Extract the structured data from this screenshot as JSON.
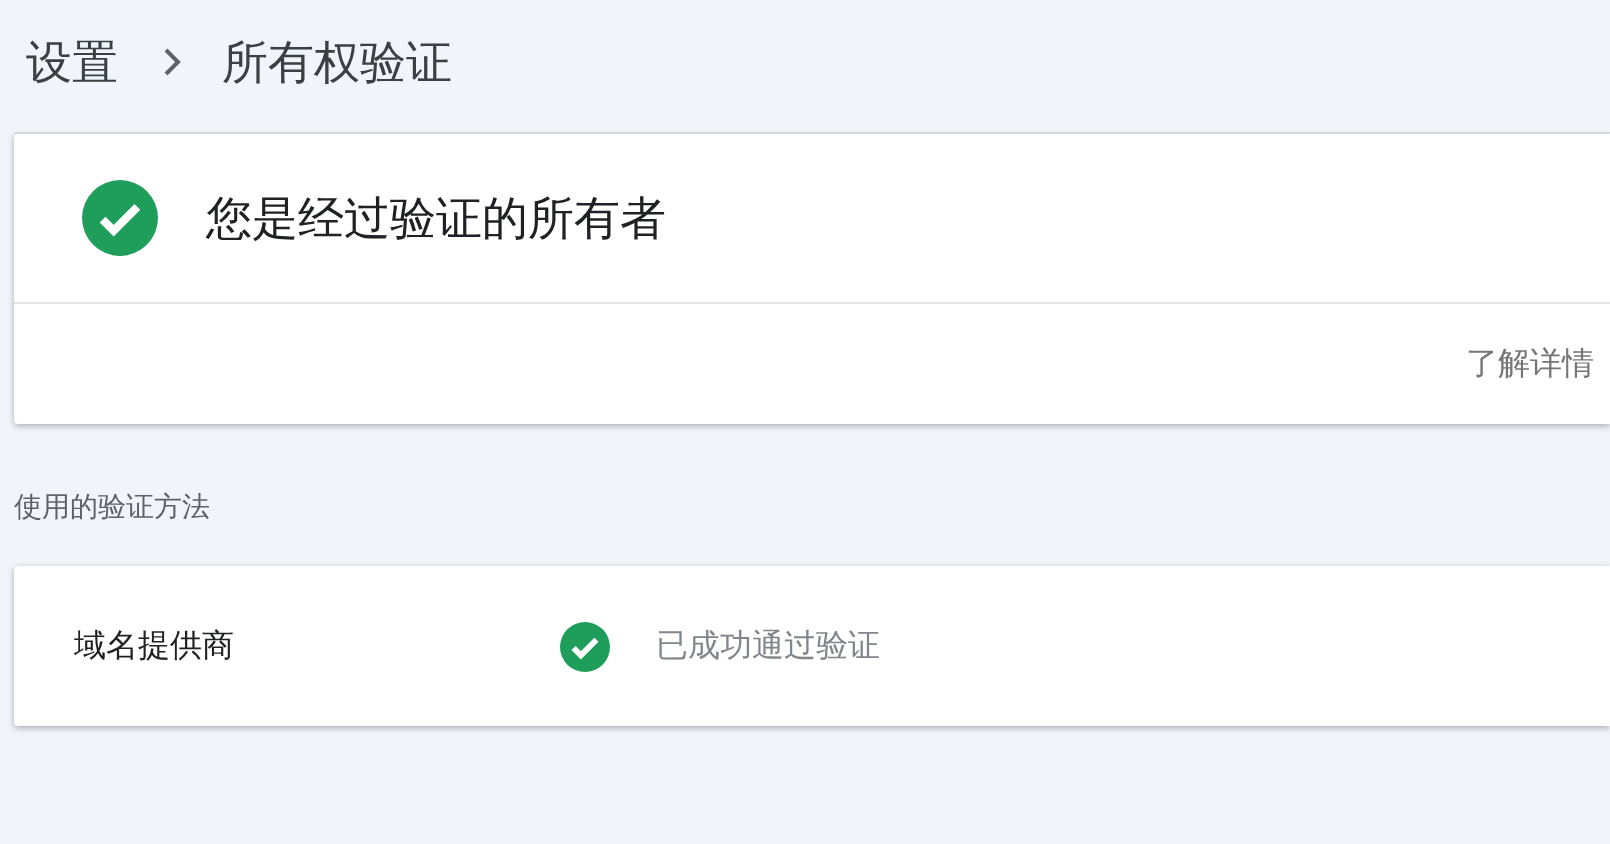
{
  "breadcrumb": [
    {
      "label": "设置"
    },
    {
      "label": "所有权验证"
    }
  ],
  "status_card": {
    "title": "您是经过验证的所有者",
    "verified": true,
    "link": "了解详情"
  },
  "methods_heading": "使用的验证方法",
  "methods": [
    {
      "name": "域名提供商",
      "status": "已成功通过验证",
      "verified": true
    }
  ]
}
